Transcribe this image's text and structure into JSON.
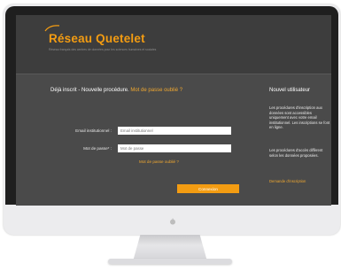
{
  "site": {
    "logo_text": "Réseau Quetelet",
    "tagline": "Réseau français des centres de données pour les sciences humaines et sociales"
  },
  "login": {
    "title_prefix": "Déjà inscrit - Nouvelle procédure.",
    "title_link": "Mot de passe oublié ?",
    "email_label": "Email institutionnel :",
    "email_placeholder": "Email institutionnel",
    "password_label": "Mot de passe* :",
    "password_placeholder": "Mot de passe",
    "forgot_link": "Mot de passe oublié ?",
    "submit_label": "Connexion"
  },
  "sidebar": {
    "title": "Nouvel utilisateur",
    "paragraph_1": "Les procédures d'inscription aux données sont accessibles uniquement avec votre email institutionnel. Les inscriptions se font en ligne.",
    "paragraph_2": "Les procédures d'accès diffèrent selon les données proposées.",
    "link": "Demande d'inscription"
  },
  "colors": {
    "accent": "#f39c12",
    "screen_bg": "#4a4a4a",
    "header_bg": "#3d3d3d"
  },
  "icons": {
    "logo_mark": "swoosh-icon",
    "monitor_logo": "apple-icon"
  }
}
